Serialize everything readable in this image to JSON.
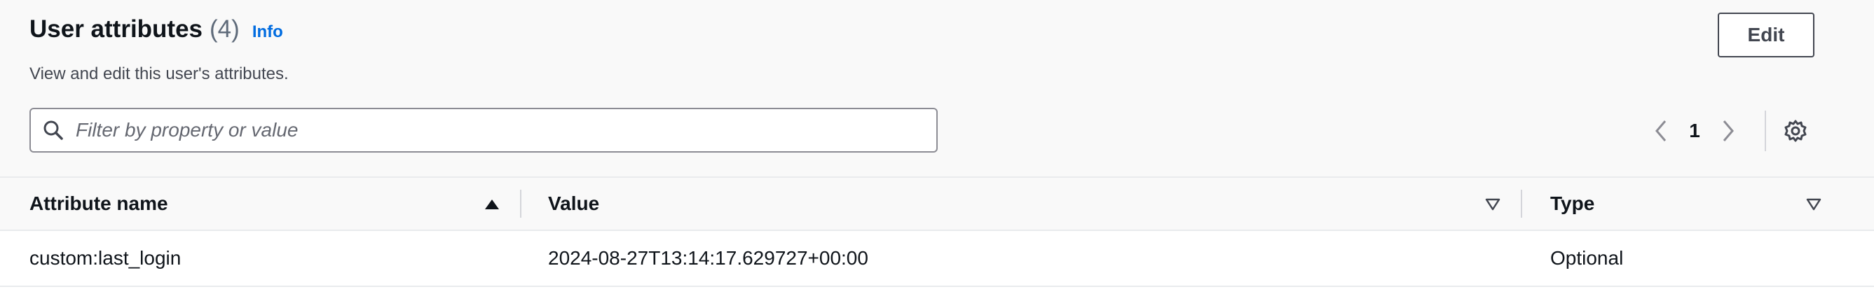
{
  "header": {
    "title": "User attributes",
    "count": "(4)",
    "info_label": "Info",
    "description": "View and edit this user's attributes.",
    "edit_label": "Edit"
  },
  "filter": {
    "placeholder": "Filter by property or value",
    "value": ""
  },
  "pagination": {
    "current_page": "1"
  },
  "table": {
    "columns": [
      {
        "label": "Attribute name",
        "sort": "ascending"
      },
      {
        "label": "Value",
        "sort": "none"
      },
      {
        "label": "Type",
        "sort": "none"
      }
    ],
    "rows": [
      {
        "name": "custom:last_login",
        "value": "2024-08-27T13:14:17.629727+00:00",
        "type": "Optional"
      }
    ]
  },
  "colors": {
    "link": "#006ce0",
    "text": "#0f141a",
    "secondary_text": "#5f6b7a",
    "border": "#8c8c94"
  },
  "icons": [
    "search-icon",
    "chevron-left-icon",
    "chevron-right-icon",
    "settings-gear-icon",
    "sort-ascending-icon",
    "sort-descending-outline-icon"
  ]
}
